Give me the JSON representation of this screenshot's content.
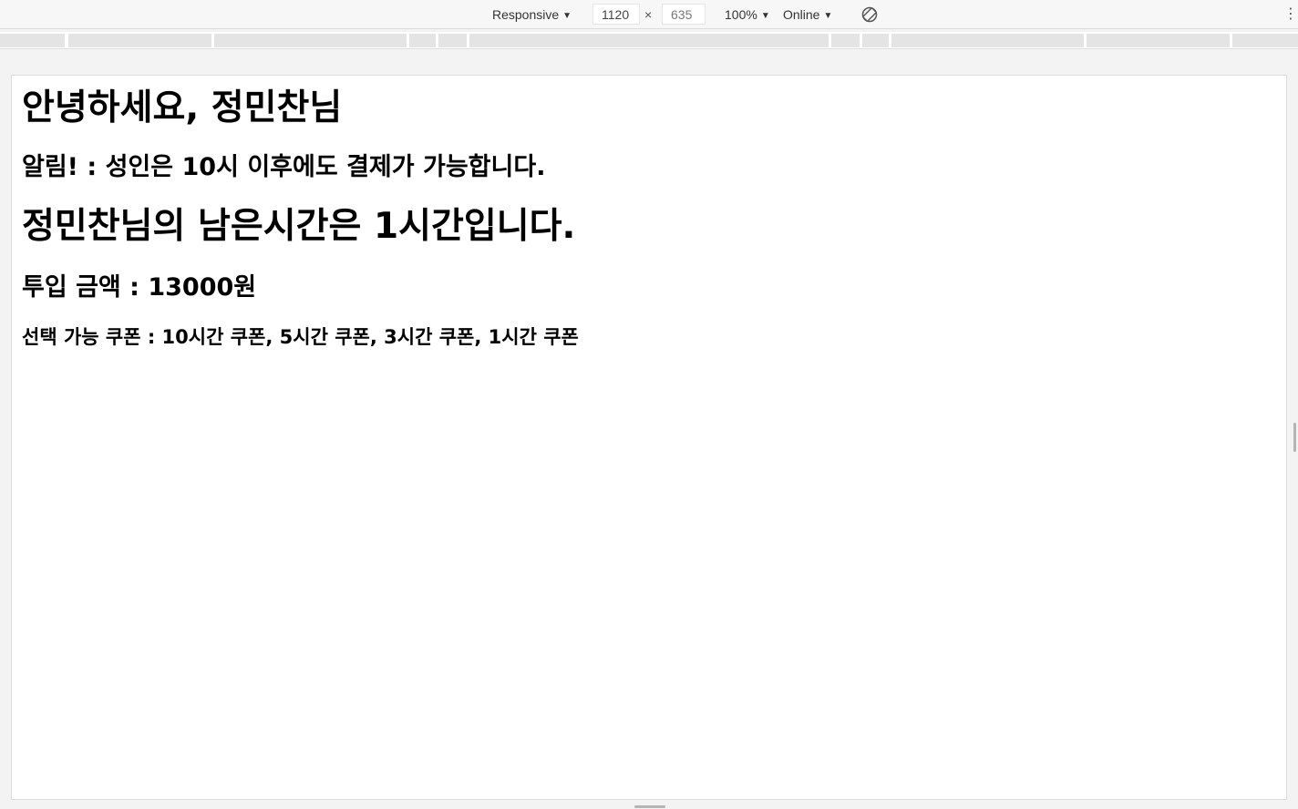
{
  "devtools": {
    "device_label": "Responsive",
    "width_value": "1120",
    "times_symbol": "×",
    "height_value": "635",
    "zoom_label": "100%",
    "network_label": "Online",
    "caret": "▼",
    "more_label": "⋮",
    "rotate_icon": "rotate-icon"
  },
  "page": {
    "greeting": "안녕하세요, 정민찬님",
    "notice": "알림! : 성인은 10시 이후에도 결제가 가능합니다.",
    "remaining_time": "정민찬님의 남은시간은 1시간입니다.",
    "inserted_amount": "투입 금액 : 13000원",
    "available_coupons": "선택 가능 쿠폰 : 10시간 쿠폰, 5시간 쿠폰, 3시간 쿠폰, 1시간 쿠폰"
  }
}
